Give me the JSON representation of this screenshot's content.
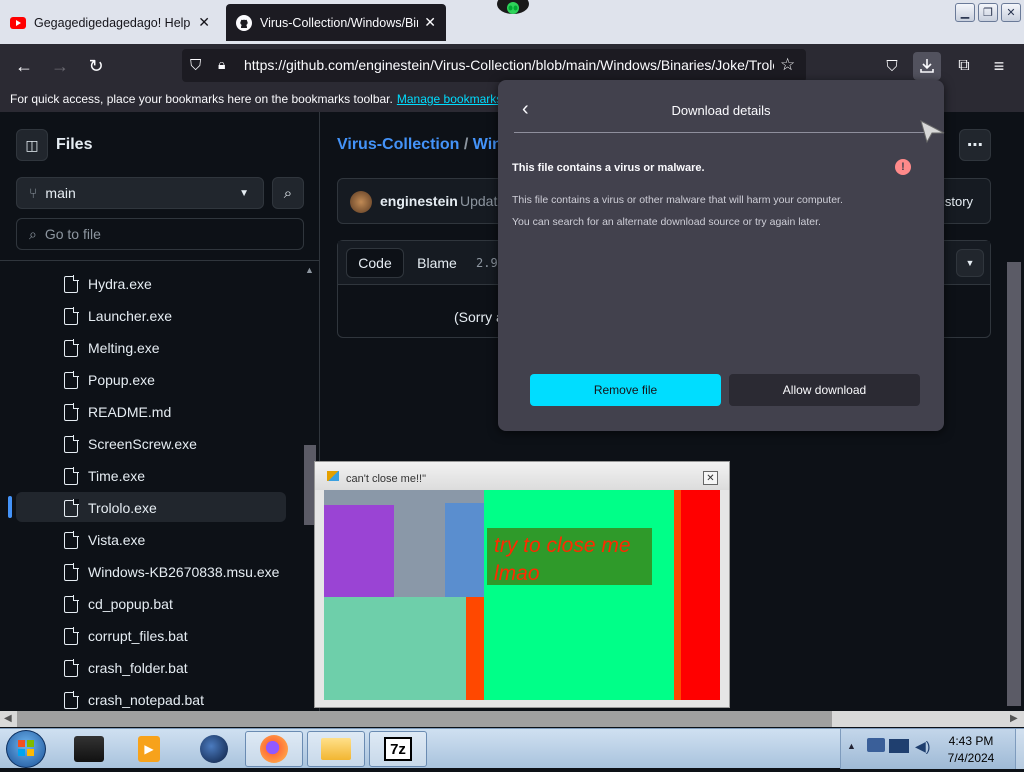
{
  "browser": {
    "tabs": [
      {
        "label": "Gegagedigedagedago! Help tha",
        "icon": "youtube-icon"
      },
      {
        "label": "Virus-Collection/Windows/Bina",
        "icon": "github-icon"
      }
    ],
    "url": "https://github.com/enginestein/Virus-Collection/blob/main/Windows/Binaries/Joke/Trololo.exe",
    "bookmarks_text": "For quick access, place your bookmarks here on the bookmarks toolbar.",
    "bookmarks_link": "Manage bookmarks..."
  },
  "github": {
    "files_title": "Files",
    "branch": "main",
    "go_to_file_placeholder": "Go to file",
    "files": [
      "Hydra.exe",
      "Launcher.exe",
      "Melting.exe",
      "Popup.exe",
      "README.md",
      "ScreenScrew.exe",
      "Time.exe",
      "Trololo.exe",
      "Vista.exe",
      "Windows-KB2670838.msu.exe",
      "cd_popup.bat",
      "corrupt_files.bat",
      "crash_folder.bat",
      "crash_notepad.bat"
    ],
    "selected_file": "Trololo.exe",
    "breadcrumb_repo": "Virus-Collection",
    "breadcrumb_sep": "/",
    "breadcrumb_next": "Wind",
    "commit_author": "enginestein",
    "commit_text": "Updat",
    "history_label": "istory",
    "code_tab": "Code",
    "blame_tab": "Blame",
    "file_size": "2.9",
    "sorry_text": "(Sorry a"
  },
  "download_panel": {
    "title": "Download details",
    "warning_title": "This file contains a virus or malware.",
    "warning_body_1": "This file contains a virus or other malware that will harm your computer.",
    "warning_body_2": "You can search for an alternate download source or try again later.",
    "remove_label": "Remove file",
    "allow_label": "Allow download"
  },
  "joke_window": {
    "title": "can't close me!!\"",
    "message_line1": "try to close me",
    "message_line2": "lmao"
  },
  "taskbar": {
    "time": "4:43 PM",
    "date": "7/4/2024",
    "sevenzip_label": "7z"
  },
  "colors": {
    "remove_button": "#00ddff",
    "link": "#4493f8",
    "joke_green": "#00ff88",
    "joke_red": "#ff0000"
  }
}
